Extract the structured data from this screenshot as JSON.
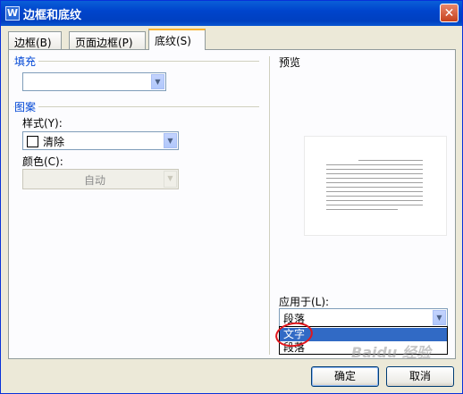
{
  "window": {
    "title": "边框和底纹",
    "icon": "W",
    "close_glyph": "✕"
  },
  "tabs": [
    {
      "label": "边框(B)",
      "active": false
    },
    {
      "label": "页面边框(P)",
      "active": false
    },
    {
      "label": "底纹(S)",
      "active": true
    }
  ],
  "fill": {
    "title": "填充",
    "value": ""
  },
  "pattern": {
    "title": "图案",
    "style_label": "样式(Y):",
    "style_value": "清除",
    "color_label": "颜色(C):",
    "color_value": "自动"
  },
  "preview": {
    "title": "预览"
  },
  "apply_to": {
    "label": "应用于(L):",
    "value": "段落",
    "options": [
      "文字",
      "段落"
    ],
    "highlighted": "文字"
  },
  "buttons": {
    "ok": "确定",
    "cancel": "取消"
  },
  "watermark": "Baidu 经验",
  "colors": {
    "title_bar": "#0044cc",
    "accent_tab": "#f8b32e",
    "group_title": "#0046d5",
    "selection": "#316ac5",
    "annotation": "#e0161c"
  }
}
